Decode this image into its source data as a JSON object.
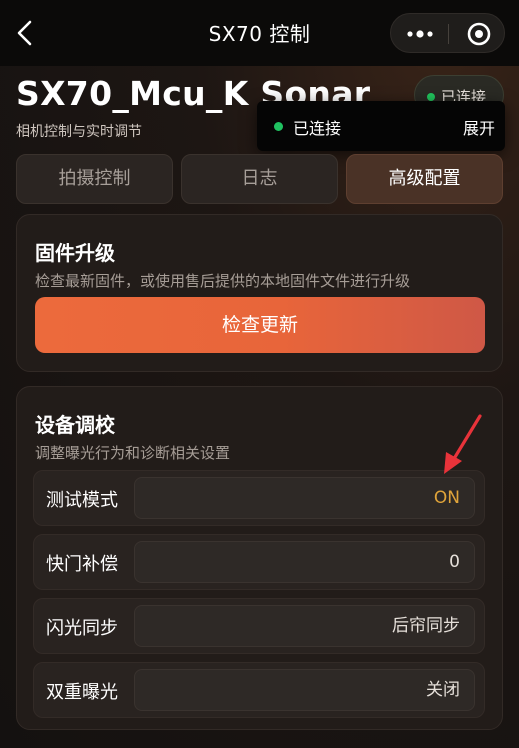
{
  "nav": {
    "title": "SX70 控制"
  },
  "header": {
    "device_name": "SX70_Mcu_K Sonar",
    "subtitle": "相机控制与实时调节",
    "status": "已连接"
  },
  "toast": {
    "status": "已连接",
    "expand": "展开"
  },
  "tabs": [
    {
      "label": "拍摄控制",
      "active": false
    },
    {
      "label": "日志",
      "active": false
    },
    {
      "label": "高级配置",
      "active": true
    }
  ],
  "firmware": {
    "title": "固件升级",
    "description": "检查最新固件，或使用售后提供的本地固件文件进行升级",
    "button": "检查更新"
  },
  "calibration": {
    "title": "设备调校",
    "description": "调整曝光行为和诊断相关设置",
    "rows": [
      {
        "label": "测试模式",
        "value": "ON"
      },
      {
        "label": "快门补偿",
        "value": "0"
      },
      {
        "label": "闪光同步",
        "value": "后帘同步"
      },
      {
        "label": "双重曝光",
        "value": "关闭"
      }
    ]
  },
  "colors": {
    "accent": "#E8653A",
    "on_value": "#E0A43A",
    "connected": "#21C55D",
    "annotation_arrow": "#E8333A"
  },
  "icons": [
    "back-arrow-icon",
    "more-dots-icon",
    "target-circle-icon",
    "status-dot-icon",
    "annotation-arrow-icon"
  ]
}
